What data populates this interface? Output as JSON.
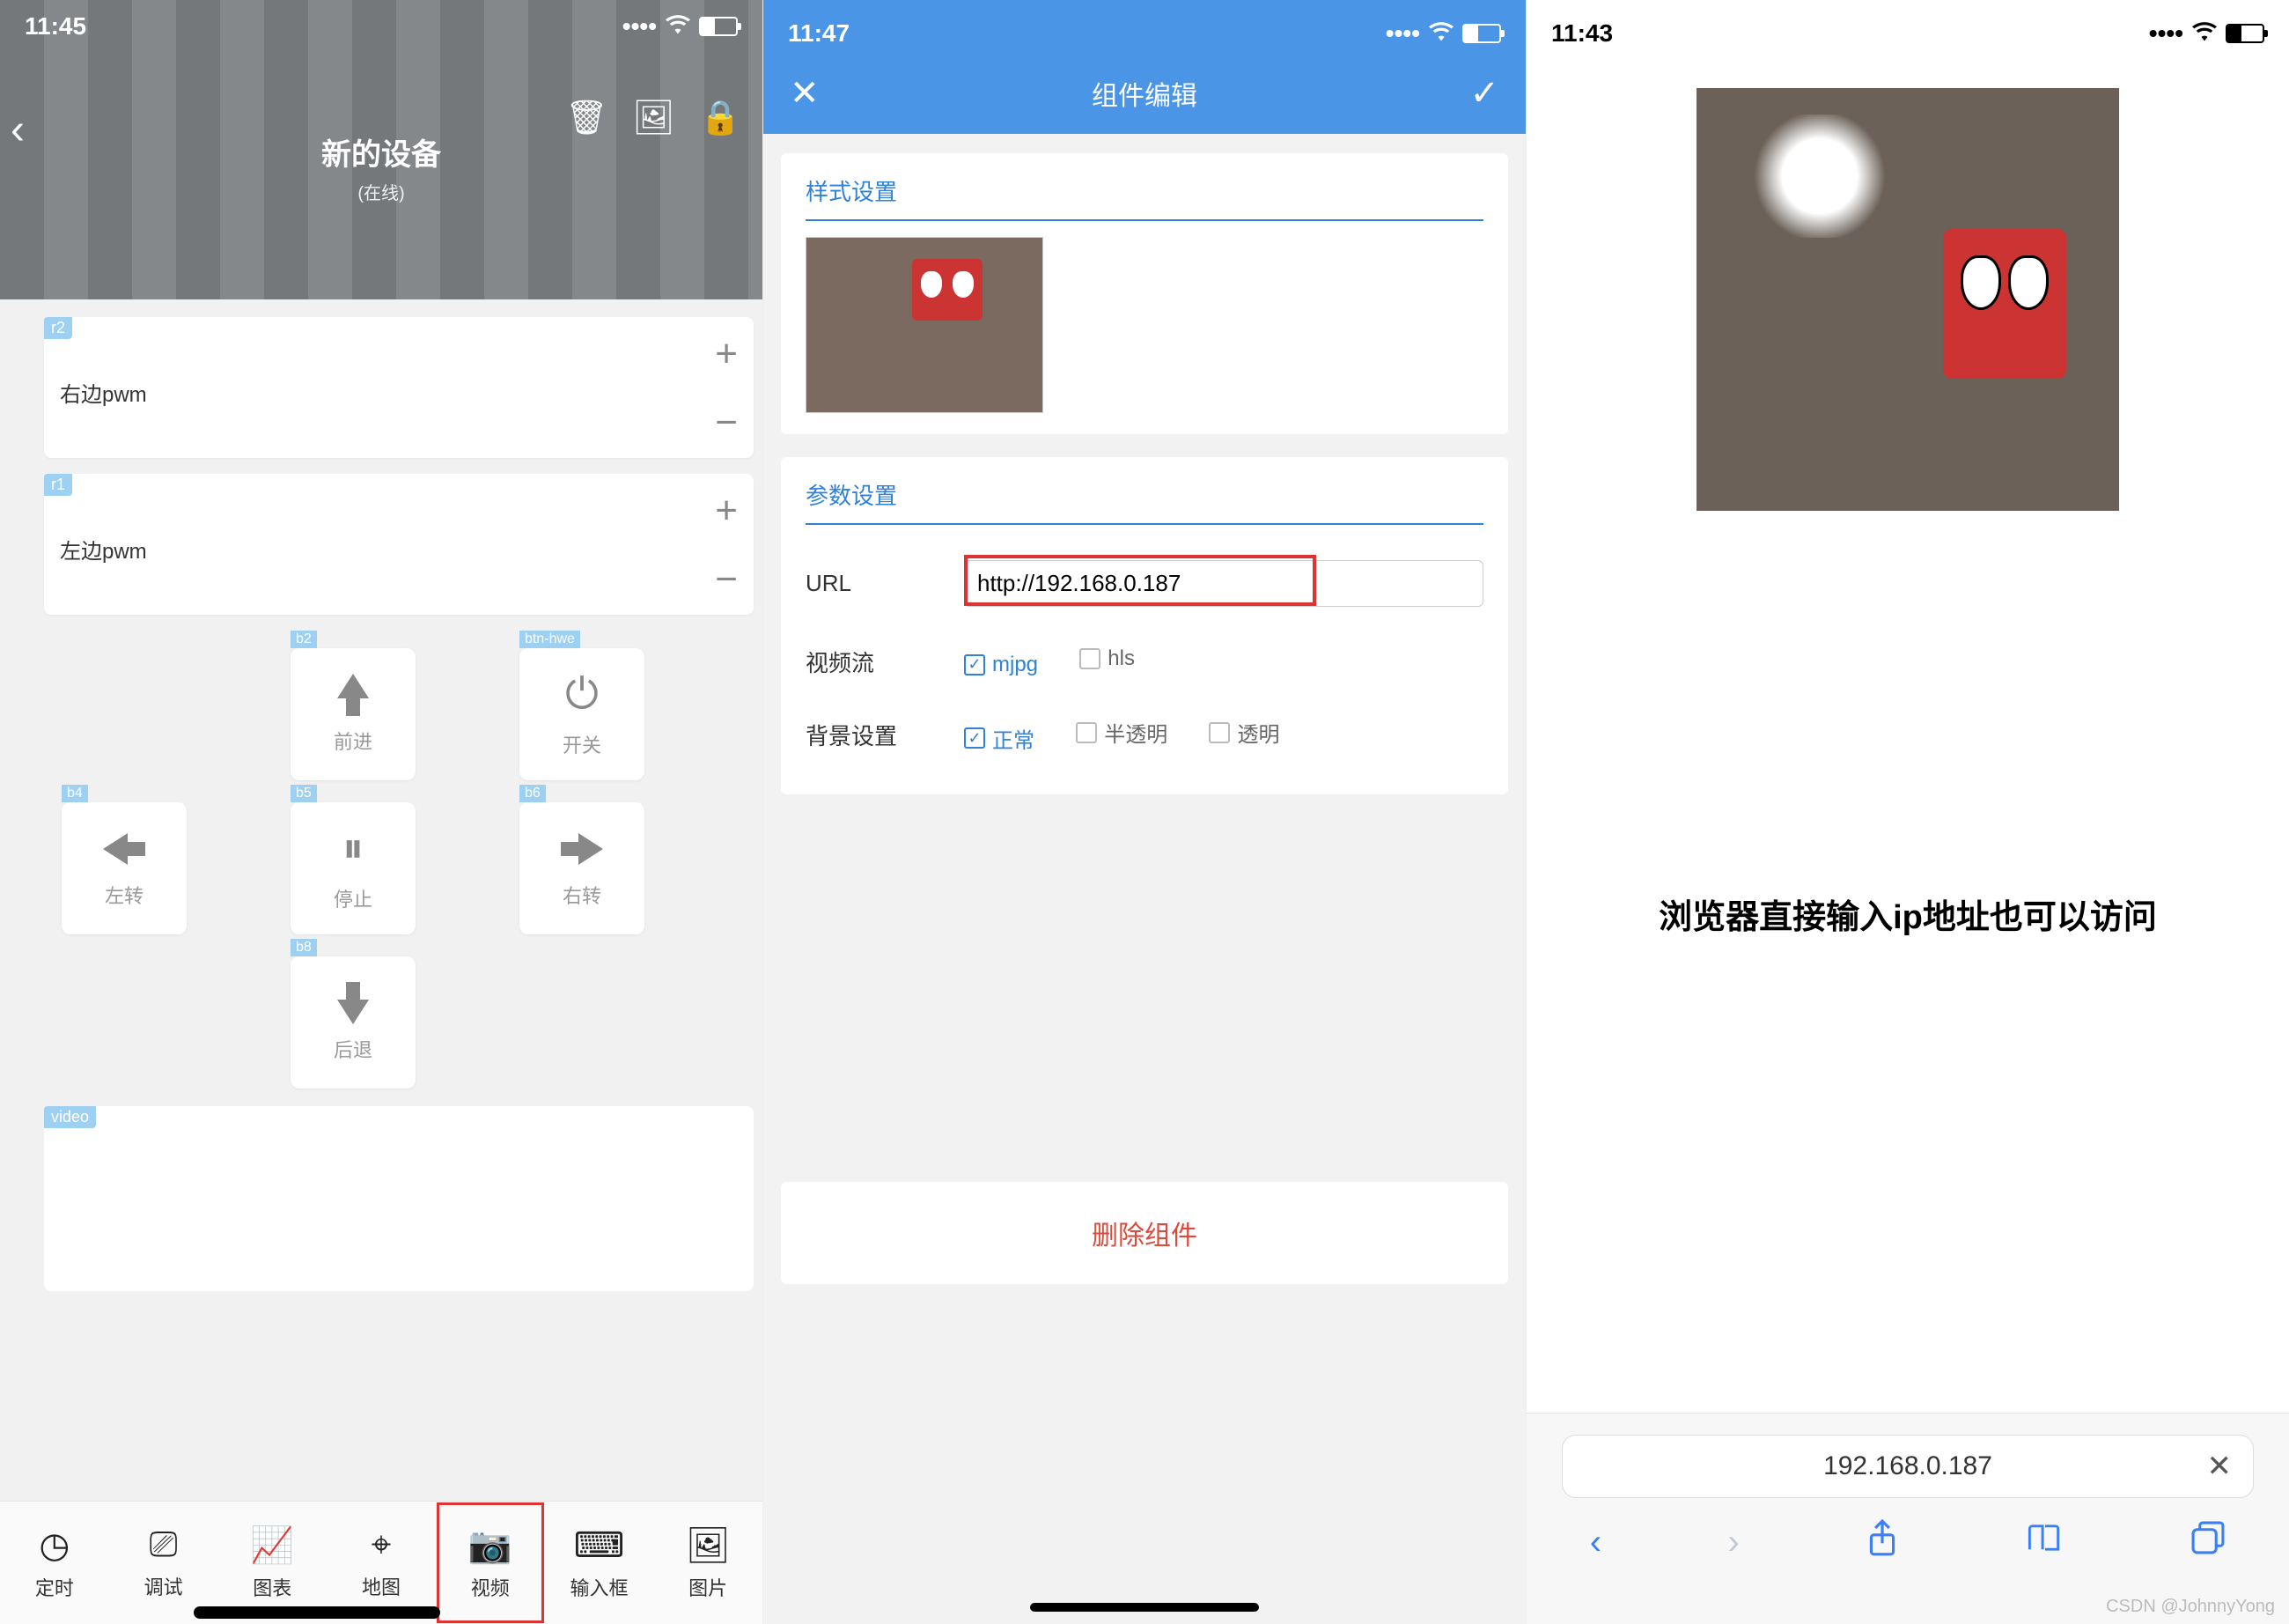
{
  "phone1": {
    "time": "11:45",
    "title": "新的设备",
    "subtitle": "(在线)",
    "cards": {
      "r2": {
        "badge": "r2",
        "label": "右边pwm"
      },
      "r1": {
        "badge": "r1",
        "label": "左边pwm"
      }
    },
    "buttons": {
      "b2": {
        "badge": "b2",
        "label": "前进"
      },
      "hwe": {
        "badge": "btn-hwe",
        "label": "开关"
      },
      "b4": {
        "badge": "b4",
        "label": "左转"
      },
      "b5": {
        "badge": "b5",
        "label": "停止"
      },
      "b6": {
        "badge": "b6",
        "label": "右转"
      },
      "b8": {
        "badge": "b8",
        "label": "后退"
      }
    },
    "video_badge": "video",
    "tabs": [
      "定时",
      "调试",
      "图表",
      "地图",
      "视频",
      "输入框",
      "图片"
    ]
  },
  "phone2": {
    "time": "11:47",
    "nav_title": "组件编辑",
    "section_style": "样式设置",
    "section_param": "参数设置",
    "url_label": "URL",
    "url_value": "http://192.168.0.187",
    "stream_label": "视频流",
    "stream_opts": {
      "mjpg": "mjpg",
      "hls": "hls"
    },
    "bg_label": "背景设置",
    "bg_opts": {
      "normal": "正常",
      "semi": "半透明",
      "trans": "透明"
    },
    "delete": "删除组件"
  },
  "phone3": {
    "time": "11:43",
    "caption": "浏览器直接输入ip地址也可以访问",
    "address": "192.168.0.187"
  },
  "watermark": "CSDN @JohnnyYong"
}
